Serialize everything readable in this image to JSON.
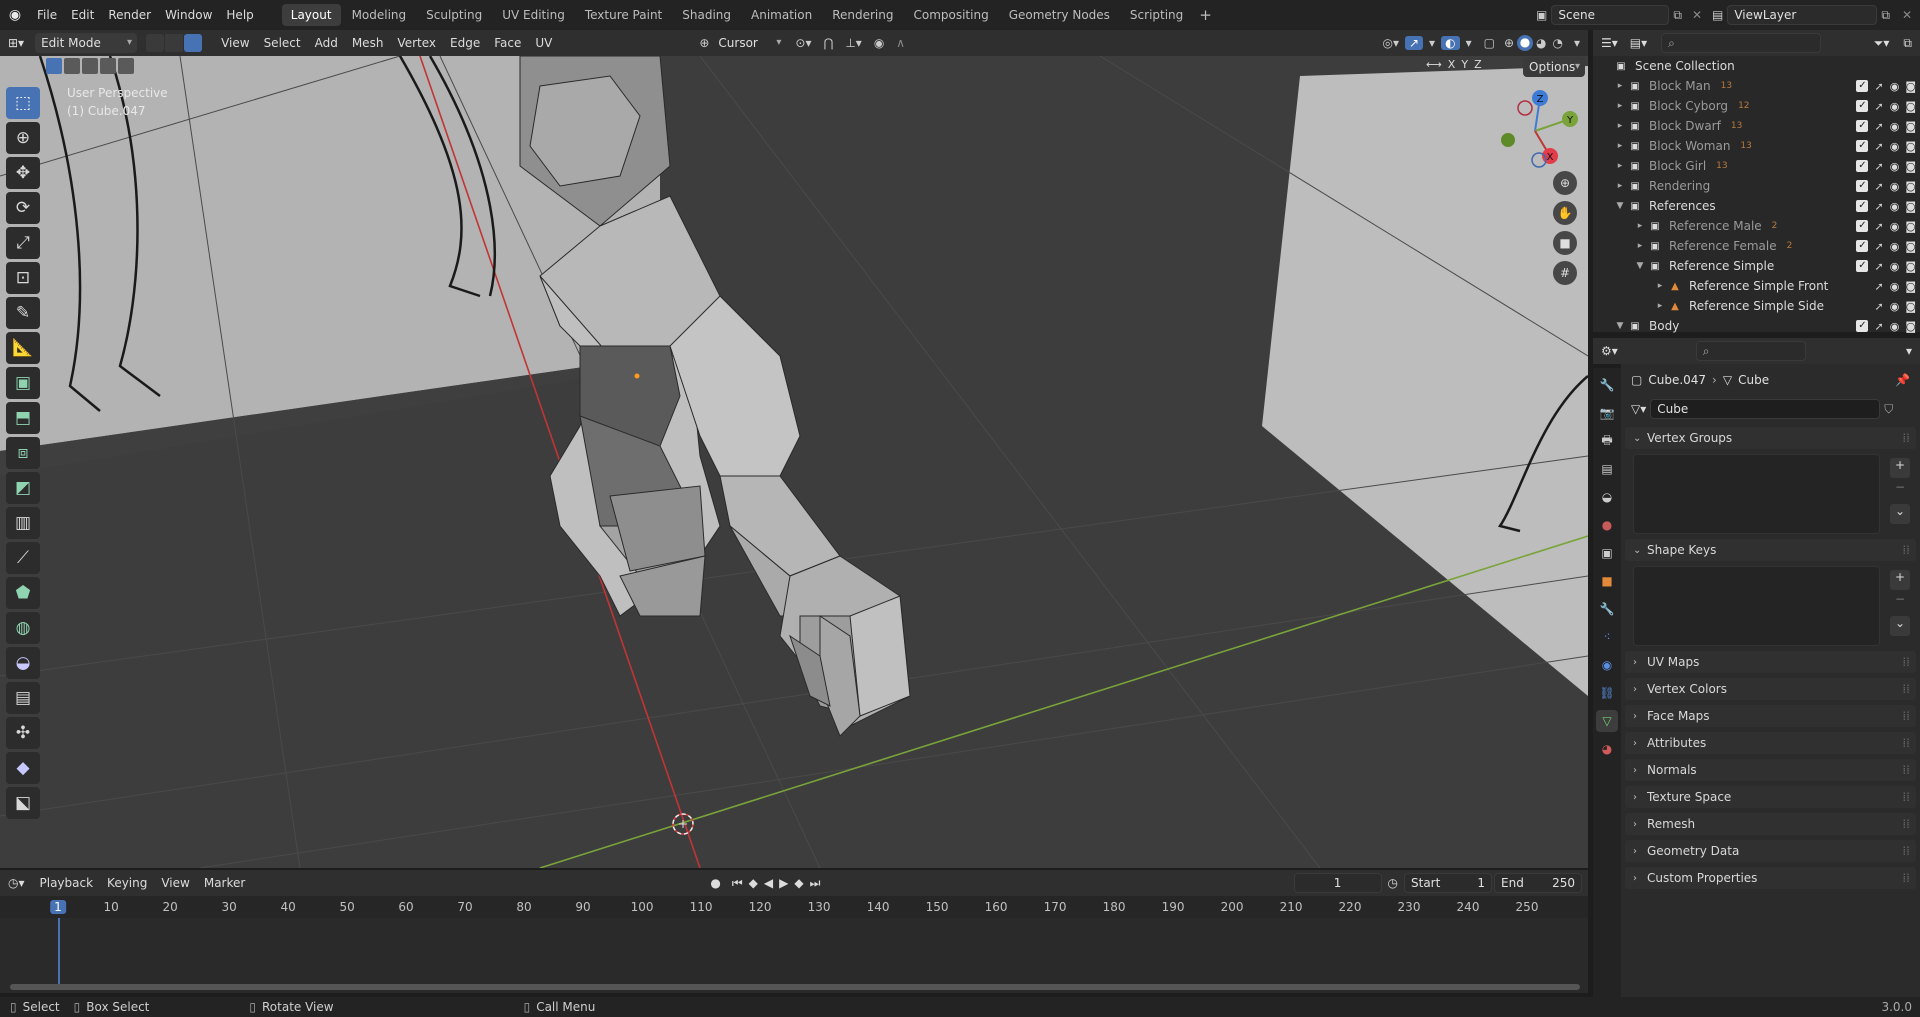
{
  "menubar": {
    "items": [
      "File",
      "Edit",
      "Render",
      "Window",
      "Help"
    ],
    "workspaces": [
      "Layout",
      "Modeling",
      "Sculpting",
      "UV Editing",
      "Texture Paint",
      "Shading",
      "Animation",
      "Rendering",
      "Compositing",
      "Geometry Nodes",
      "Scripting"
    ],
    "active_workspace": "Layout",
    "scene": "Scene",
    "view_layer": "ViewLayer"
  },
  "viewport_header": {
    "mode": "Edit Mode",
    "menus": [
      "View",
      "Select",
      "Add",
      "Mesh",
      "Vertex",
      "Edge",
      "Face",
      "UV"
    ],
    "pivot": "Cursor",
    "axes": [
      "X",
      "Y",
      "Z"
    ],
    "options": "Options"
  },
  "viewport": {
    "view_name": "User Perspective",
    "object_name": "(1) Cube.047",
    "gizmo": {
      "z": "Z",
      "y": "Y",
      "x": "X"
    }
  },
  "outliner": {
    "root": "Scene Collection",
    "rows": [
      {
        "name": "Block Man",
        "badge": "13",
        "indent": 0
      },
      {
        "name": "Block Cyborg",
        "badge": "12",
        "indent": 0
      },
      {
        "name": "Block Dwarf",
        "badge": "13",
        "indent": 0
      },
      {
        "name": "Block Woman",
        "badge": "13",
        "indent": 0
      },
      {
        "name": "Block Girl",
        "badge": "13",
        "indent": 0
      },
      {
        "name": "Rendering",
        "badge": "",
        "indent": 0
      },
      {
        "name": "References",
        "badge": "",
        "indent": 0
      },
      {
        "name": "Reference Male",
        "badge": "2",
        "indent": 1
      },
      {
        "name": "Reference Female",
        "badge": "2",
        "indent": 1
      },
      {
        "name": "Reference Simple",
        "badge": "",
        "indent": 1
      },
      {
        "name": "Reference Simple Front",
        "badge": "",
        "indent": 2
      },
      {
        "name": "Reference Simple Side",
        "badge": "",
        "indent": 2
      },
      {
        "name": "Body",
        "badge": "",
        "indent": 0
      }
    ]
  },
  "properties": {
    "breadcrumb_object": "Cube.047",
    "breadcrumb_data": "Cube",
    "mesh_name": "Cube",
    "panels": [
      "Vertex Groups",
      "Shape Keys",
      "UV Maps",
      "Vertex Colors",
      "Face Maps",
      "Attributes",
      "Normals",
      "Texture Space",
      "Remesh",
      "Geometry Data",
      "Custom Properties"
    ]
  },
  "timeline": {
    "menus": [
      "Playback",
      "Keying",
      "View",
      "Marker"
    ],
    "current_frame": "1",
    "start_label": "Start",
    "start": "1",
    "end_label": "End",
    "end": "250",
    "ruler": [
      "1",
      "10",
      "20",
      "30",
      "40",
      "50",
      "60",
      "70",
      "80",
      "90",
      "100",
      "110",
      "120",
      "130",
      "140",
      "150",
      "160",
      "170",
      "180",
      "190",
      "200",
      "210",
      "220",
      "230",
      "240",
      "250"
    ]
  },
  "statusbar": {
    "select": "Select",
    "box_select": "Box Select",
    "rotate": "Rotate View",
    "call_menu": "Call Menu",
    "version": "3.0.0"
  },
  "colors": {
    "accent": "#4772b3",
    "x_axis": "#c03535",
    "y_axis": "#7aa33a",
    "bg": "#1d1d1d"
  }
}
